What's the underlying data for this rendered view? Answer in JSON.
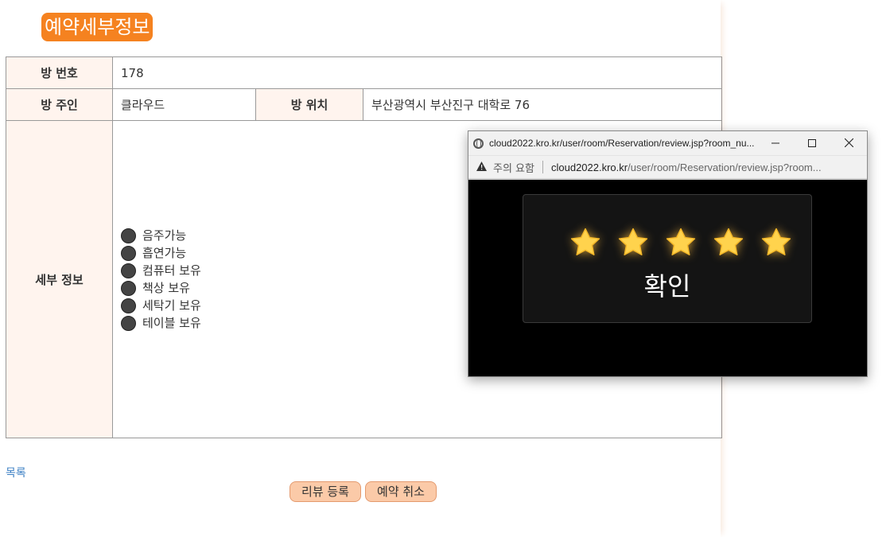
{
  "page": {
    "title": "예약세부정보",
    "list_link": "목록",
    "buttons": {
      "review": "리뷰 등록",
      "cancel": "예약 취소"
    }
  },
  "table": {
    "room_number_label": "방 번호",
    "room_number": "178",
    "owner_label": "방 주인",
    "owner": "클라우드",
    "location_label": "방 위치",
    "location": "부산광역시 부산진구 대학로 76",
    "details_label": "세부 정보",
    "features": [
      "음주가능",
      "흡연가능",
      "컴퓨터 보유",
      "책상 보유",
      "세탁기 보유",
      "테이블 보유"
    ]
  },
  "popup": {
    "title": "cloud2022.kro.kr/user/room/Reservation/review.jsp?room_nu...",
    "security_warning": "주의 요함",
    "url_host": "cloud2022.kro.kr",
    "url_path": "/user/room/Reservation/review.jsp?room...",
    "rating": 5,
    "confirm_label": "확인",
    "icons": [
      "globe-icon",
      "minimize-icon",
      "maximize-icon",
      "close-icon",
      "warning-icon",
      "star-icon"
    ]
  },
  "colors": {
    "accent": "#f58220",
    "header_bg": "#fff4ee",
    "button_bg": "#fbcaa8",
    "star": "#ffd34d"
  }
}
